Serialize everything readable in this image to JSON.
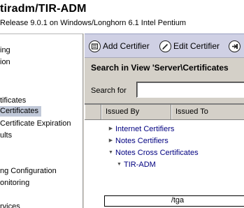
{
  "window": {
    "title": "tiradm/TIR-ADM",
    "subtitle": "Release 9.0.1 on Windows/Longhorn 6.1 Intel Pentium"
  },
  "nav": {
    "items": [
      {
        "label": "ing"
      },
      {
        "label": "ion"
      },
      {
        "label": "tificates"
      },
      {
        "label": "Certificates",
        "selected": true
      },
      {
        "label": "Certificate Expiration"
      },
      {
        "label": "ults"
      },
      {
        "label": "ng Configuration"
      },
      {
        "label": "onitoring"
      },
      {
        "label": "rvices"
      }
    ]
  },
  "toolbar": {
    "add_certifier": {
      "label": "Add Certifier",
      "icon": "add-certifier-icon"
    },
    "edit_certifier": {
      "label": "Edit Certifier",
      "icon": "edit-pencil-icon"
    },
    "next_action": {
      "label": "",
      "icon": "arrow-right-icon"
    }
  },
  "view": {
    "title": "Search in View 'Server\\Certificates"
  },
  "search": {
    "label": "Search for",
    "value": ""
  },
  "table": {
    "columns": [
      "Issued By",
      "Issued To"
    ],
    "rows": [
      {
        "label": "Internet Certifiers",
        "expanded": false,
        "level": 0
      },
      {
        "label": "Notes Certifiers",
        "expanded": false,
        "level": 0
      },
      {
        "label": "Notes Cross Certificates",
        "expanded": true,
        "level": 0
      },
      {
        "label": "TIR-ADM",
        "expanded": true,
        "level": 1
      }
    ]
  },
  "status": {
    "text": "/tga"
  },
  "colors": {
    "toolbar_bg": "#cfd0e4",
    "panel_bg": "#d4d0c8",
    "selected_bg": "#c0c8d8",
    "tree_text": "#000080"
  }
}
